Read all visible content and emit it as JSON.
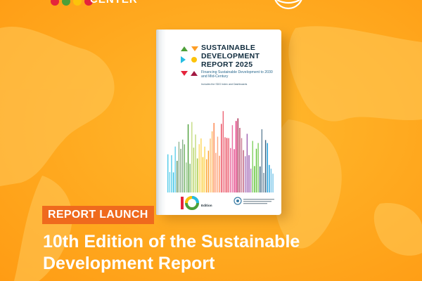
{
  "header": {
    "org_logo_text": "CENTER",
    "logo_icon": "colored-dots-logo",
    "partner_icon": "ring-lines-logo"
  },
  "book": {
    "title_line1": "SUSTAINABLE",
    "title_line2": "DEVELOPMENT",
    "title_line3": "REPORT 2025",
    "subtitle": "Financing Sustainable Development to 2030 and Mid-Century",
    "note": "Includes the SDG Index and Dashboards",
    "edition_label": "Edition"
  },
  "badge": {
    "label": "REPORT LAUNCH"
  },
  "headline": {
    "line1": "10th Edition of the Sustainable",
    "line2": "Development Report"
  },
  "colors": {
    "background": "#ffa91f",
    "badge": "#ef6a1d",
    "text": "#ffffff"
  }
}
